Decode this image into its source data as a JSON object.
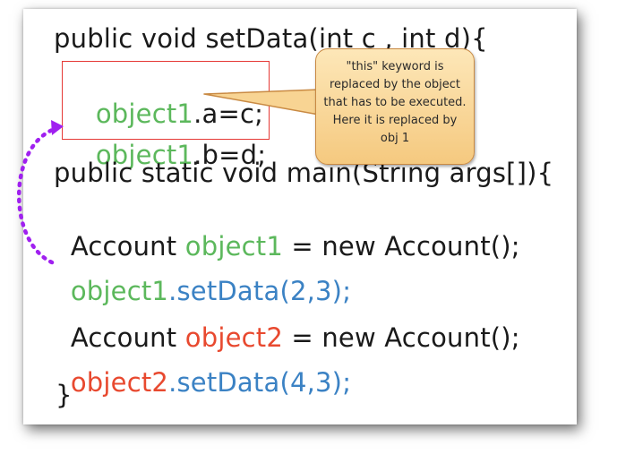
{
  "code": {
    "line1": "public void setData(int c , int d){",
    "line2": {
      "obj": "object1",
      "rest": ".a=c;"
    },
    "line3": {
      "obj": "object1",
      "rest": ".b=d;"
    },
    "line4": "public static void main(String args[]){",
    "line5": {
      "pre": "Account ",
      "obj": "object1",
      "post": " = new Account();"
    },
    "line6": {
      "obj": "object1",
      "call": ".setData(2,3);"
    },
    "line7": {
      "pre": "Account ",
      "obj": "object2",
      "post": " = new Account();"
    },
    "line8": {
      "obj": "object2",
      "call": ".setData(4,3);"
    },
    "line9": "}"
  },
  "callout": {
    "text": "\"this\" keyword is replaced by the object that has to be executed.  Here it is replaced by obj 1"
  },
  "colors": {
    "object1": "#5cb85c",
    "object2": "#e8492f",
    "method_call": "#3b82c4",
    "arrow": "#a020f0",
    "highlight_border": "#e53935",
    "callout_fill": "#f9d99a"
  }
}
